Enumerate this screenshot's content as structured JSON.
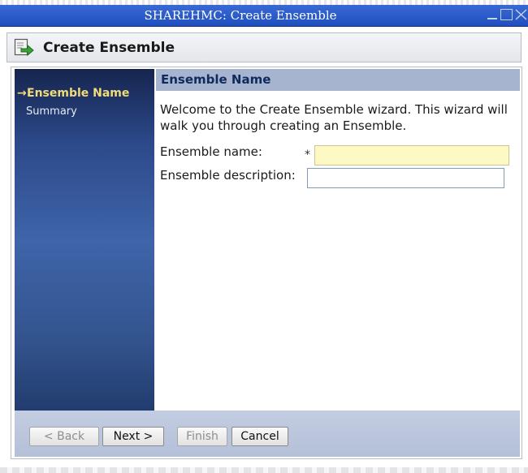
{
  "window": {
    "title": "SHAREHMC: Create Ensemble"
  },
  "header": {
    "title": "Create Ensemble",
    "icon": "wizard-arrow-icon"
  },
  "sidebar": {
    "active_marker": "→",
    "items": [
      {
        "label": "Ensemble Name",
        "active": true
      },
      {
        "label": "Summary",
        "active": false
      }
    ]
  },
  "content": {
    "title": "Ensemble Name",
    "welcome": "Welcome to the Create Ensemble wizard. This wizard will walk you through creating an Ensemble.",
    "fields": {
      "name_label": "Ensemble name:",
      "name_required_mark": "*",
      "name_value": "",
      "description_label": "Ensemble description:",
      "description_value": ""
    }
  },
  "footer": {
    "back": "< Back",
    "next": "Next >",
    "finish": "Finish",
    "cancel": "Cancel"
  },
  "colors": {
    "titlebar": "#1f4fbf",
    "sidebar_dark": "#16254f",
    "sidebar_mid": "#3f64aa",
    "active_nav": "#f2dc79",
    "content_header": "#a6b4d0",
    "required_input_bg": "#fdf9c4"
  }
}
